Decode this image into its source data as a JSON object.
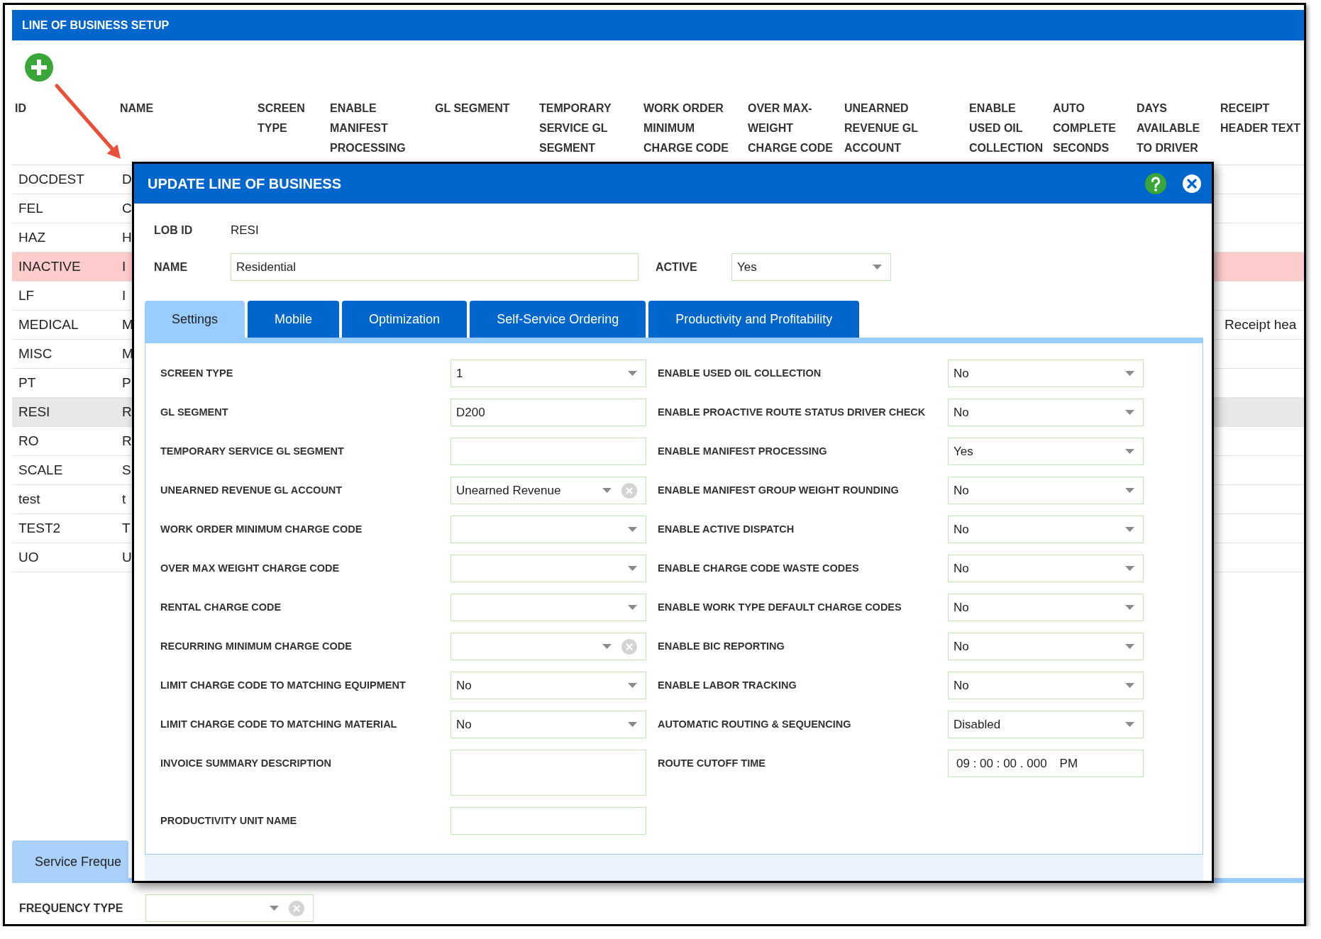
{
  "window": {
    "title": "LINE OF BUSINESS SETUP"
  },
  "table": {
    "columns": [
      "ID",
      "NAME",
      "SCREEN TYPE",
      "ENABLE MANIFEST PROCESSING",
      "GL SEGMENT",
      "TEMPORARY SERVICE GL SEGMENT",
      "WORK ORDER MINIMUM CHARGE CODE",
      "OVER MAX-WEIGHT CHARGE CODE",
      "UNEARNED REVENUE GL ACCOUNT",
      "ENABLE USED OIL COLLECTION",
      "AUTO COMPLETE SECONDS",
      "DAYS AVAILABLE TO DRIVER",
      "RECEIPT HEADER TEXT"
    ],
    "rows": [
      {
        "id": "DOCDEST",
        "name": "D",
        "inactive": false,
        "selected": false
      },
      {
        "id": "FEL",
        "name": "C",
        "inactive": false,
        "selected": false
      },
      {
        "id": "HAZ",
        "name": "H",
        "inactive": false,
        "selected": false
      },
      {
        "id": "INACTIVE",
        "name": "I",
        "inactive": true,
        "selected": false
      },
      {
        "id": "LF",
        "name": "I",
        "inactive": false,
        "selected": false
      },
      {
        "id": "MEDICAL",
        "name": "M",
        "receipt_header_text": "Receipt hea",
        "inactive": false,
        "selected": false
      },
      {
        "id": "MISC",
        "name": "M",
        "inactive": false,
        "selected": false
      },
      {
        "id": "PT",
        "name": "P",
        "inactive": false,
        "selected": false
      },
      {
        "id": "RESI",
        "name": "R",
        "inactive": false,
        "selected": true
      },
      {
        "id": "RO",
        "name": "R",
        "inactive": false,
        "selected": false
      },
      {
        "id": "SCALE",
        "name": "S",
        "inactive": false,
        "selected": false
      },
      {
        "id": "test",
        "name": "t",
        "inactive": false,
        "selected": false
      },
      {
        "id": "TEST2",
        "name": "T",
        "inactive": false,
        "selected": false
      },
      {
        "id": "UO",
        "name": "U",
        "inactive": false,
        "selected": false
      }
    ]
  },
  "modal": {
    "title": "UPDATE LINE OF BUSINESS",
    "lob_id": {
      "label": "LOB ID",
      "value": "RESI"
    },
    "name": {
      "label": "NAME",
      "value": "Residential"
    },
    "active": {
      "label": "ACTIVE",
      "value": "Yes"
    },
    "tabs": [
      {
        "label": "Settings",
        "selected": true
      },
      {
        "label": "Mobile",
        "selected": false
      },
      {
        "label": "Optimization",
        "selected": false
      },
      {
        "label": "Self-Service Ordering",
        "selected": false
      },
      {
        "label": "Productivity and Profitability",
        "selected": false
      }
    ],
    "left_fields": [
      {
        "label": "SCREEN TYPE",
        "kind": "select",
        "value": "1"
      },
      {
        "label": "GL SEGMENT",
        "kind": "text",
        "value": "D200"
      },
      {
        "label": "TEMPORARY SERVICE GL SEGMENT",
        "kind": "text"
      },
      {
        "label": "UNEARNED REVENUE GL ACCOUNT",
        "kind": "combo",
        "value": "Unearned Revenue"
      },
      {
        "label": "WORK ORDER MINIMUM CHARGE CODE",
        "kind": "select"
      },
      {
        "label": "OVER MAX WEIGHT CHARGE CODE",
        "kind": "select"
      },
      {
        "label": "RENTAL CHARGE CODE",
        "kind": "select"
      },
      {
        "label": "RECURRING MINIMUM CHARGE CODE",
        "kind": "combo"
      },
      {
        "label": "LIMIT CHARGE CODE TO MATCHING EQUIPMENT",
        "kind": "select",
        "value": "No"
      },
      {
        "label": "LIMIT CHARGE CODE TO MATCHING MATERIAL",
        "kind": "select",
        "value": "No"
      },
      {
        "label": "INVOICE SUMMARY DESCRIPTION",
        "kind": "textarea"
      },
      {
        "label": "PRODUCTIVITY UNIT NAME",
        "kind": "text"
      }
    ],
    "right_fields": [
      {
        "label": "ENABLE USED OIL COLLECTION",
        "kind": "select",
        "value": "No"
      },
      {
        "label": "ENABLE PROACTIVE ROUTE STATUS DRIVER CHECK",
        "kind": "select",
        "value": "No"
      },
      {
        "label": "ENABLE MANIFEST PROCESSING",
        "kind": "select",
        "value": "Yes"
      },
      {
        "label": "ENABLE MANIFEST GROUP WEIGHT ROUNDING",
        "kind": "select",
        "value": "No"
      },
      {
        "label": "ENABLE ACTIVE DISPATCH",
        "kind": "select",
        "value": "No"
      },
      {
        "label": "ENABLE CHARGE CODE WASTE CODES",
        "kind": "select",
        "value": "No"
      },
      {
        "label": "ENABLE WORK TYPE DEFAULT CHARGE CODES",
        "kind": "select",
        "value": "No"
      },
      {
        "label": "ENABLE BIC REPORTING",
        "kind": "select",
        "value": "No"
      },
      {
        "label": "ENABLE LABOR TRACKING",
        "kind": "select",
        "value": "No"
      },
      {
        "label": "AUTOMATIC ROUTING & SEQUENCING",
        "kind": "select",
        "value": "Disabled"
      },
      {
        "label": "ROUTE CUTOFF TIME",
        "kind": "time",
        "value": "09 : 00 : 00 . 000",
        "meridiem": "PM"
      }
    ]
  },
  "service_frequency": {
    "tab": {
      "label": "Service Freque",
      "selected": true
    },
    "frequency_type": {
      "label": "FREQUENCY TYPE",
      "kind": "combo"
    }
  }
}
